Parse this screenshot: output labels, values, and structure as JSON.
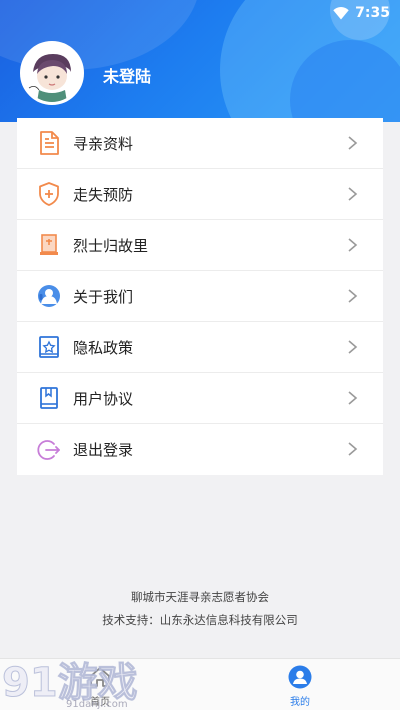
{
  "status_bar": {
    "time": "7:35",
    "wifi_icon": "wifi-icon"
  },
  "profile": {
    "name": "未登陆",
    "avatar_icon": "user-avatar"
  },
  "menu": {
    "items": [
      {
        "label": "寻亲资料",
        "icon": "document-icon",
        "color": "#f28a4c"
      },
      {
        "label": "走失预防",
        "icon": "shield-plus-icon",
        "color": "#f28a4c"
      },
      {
        "label": "烈士归故里",
        "icon": "memorial-icon",
        "color": "#f28a4c"
      },
      {
        "label": "关于我们",
        "icon": "headset-icon",
        "color": "#4a8ee8"
      },
      {
        "label": "隐私政策",
        "icon": "star-card-icon",
        "color": "#2f74d9"
      },
      {
        "label": "用户协议",
        "icon": "book-icon",
        "color": "#2f74d9"
      },
      {
        "label": "退出登录",
        "icon": "logout-icon",
        "color": "#c77dd8"
      }
    ]
  },
  "footer": {
    "org": "聊城市天涯寻亲志愿者协会",
    "support": "技术支持：山东永达信息科技有限公司"
  },
  "tabbar": {
    "home_label": "首页",
    "mine_label": "我的",
    "active_color": "#2b7de9"
  },
  "watermark": {
    "text": "91游戏",
    "sub": "91danji.com"
  }
}
